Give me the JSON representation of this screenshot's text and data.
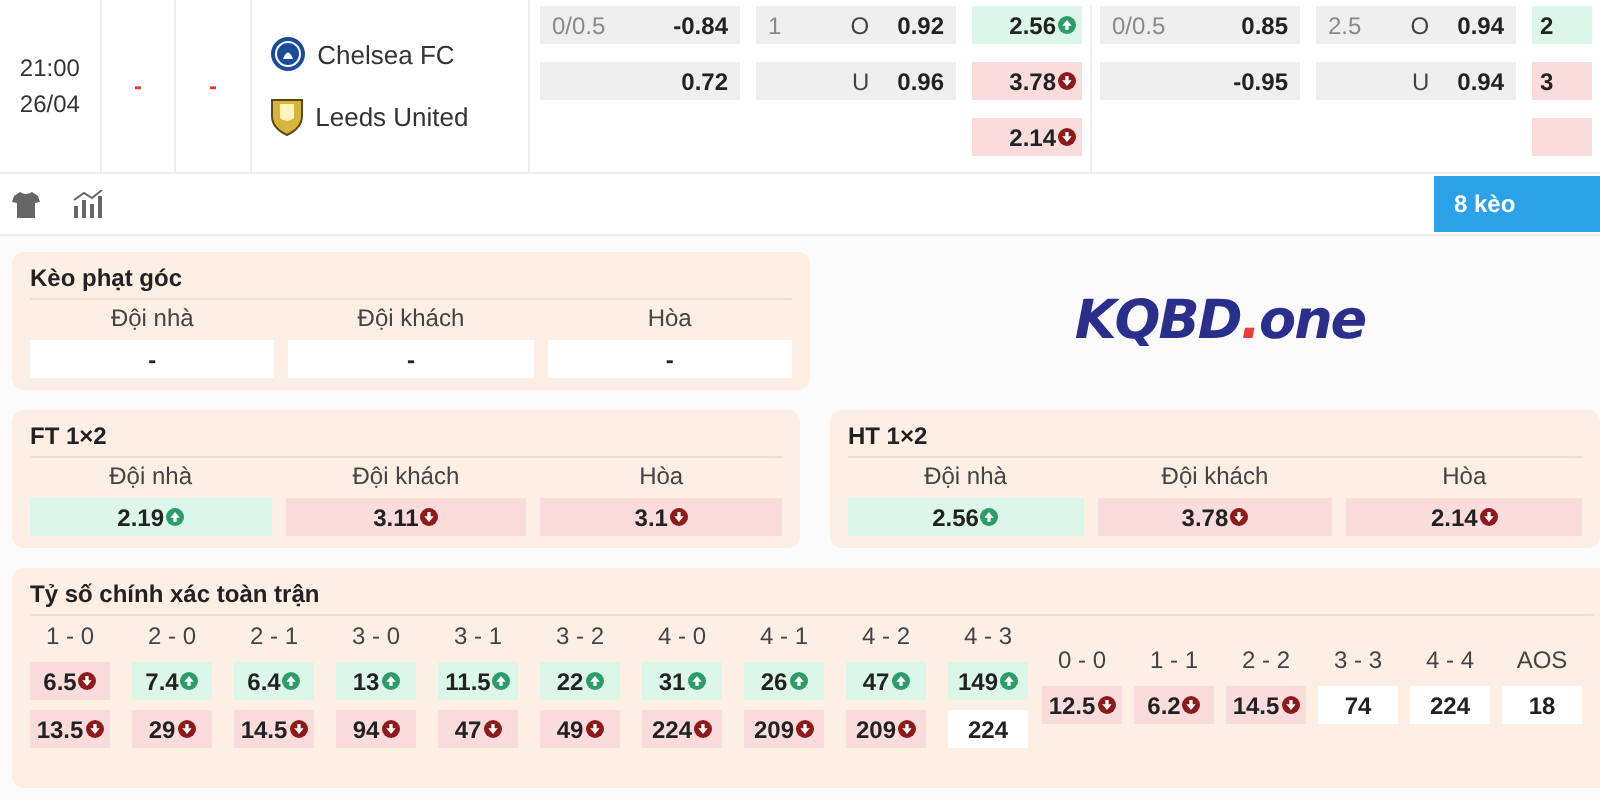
{
  "match": {
    "time": "21:00",
    "date": "26/04",
    "score_home": "-",
    "score_away": "-",
    "teams": [
      {
        "name": "Chelsea FC"
      },
      {
        "name": "Leeds United"
      }
    ]
  },
  "odds_sections": [
    {
      "groups": [
        {
          "kind": "handicap",
          "rows": [
            {
              "line": "0/0.5",
              "value": "-0.84"
            },
            {
              "value": "0.72"
            }
          ]
        },
        {
          "kind": "overunder",
          "rows": [
            {
              "line": "1",
              "side": "O",
              "value": "0.92"
            },
            {
              "side": "U",
              "value": "0.96"
            }
          ]
        },
        {
          "kind": "matchodds",
          "clipped": false,
          "rows": [
            {
              "value": "2.56",
              "kind": "up"
            },
            {
              "value": "3.78",
              "kind": "down"
            },
            {
              "value": "2.14",
              "kind": "down"
            }
          ]
        }
      ]
    },
    {
      "groups": [
        {
          "kind": "handicap",
          "rows": [
            {
              "line": "0/0.5",
              "value": "0.85"
            },
            {
              "value": "-0.95"
            }
          ]
        },
        {
          "kind": "overunder",
          "rows": [
            {
              "line": "2.5",
              "side": "O",
              "value": "0.94"
            },
            {
              "side": "U",
              "value": "0.94"
            }
          ]
        },
        {
          "kind": "matchodds",
          "clipped": true,
          "rows": [
            {
              "value": "2",
              "kind": "up"
            },
            {
              "value": "3",
              "kind": "down"
            },
            {
              "kind": "down"
            }
          ]
        }
      ]
    }
  ],
  "toolbar": {
    "more_button": "8 kèo"
  },
  "corner": {
    "title": "Kèo phạt góc",
    "columns": [
      {
        "label": "Đội nhà",
        "value": "-",
        "kind": "plain"
      },
      {
        "label": "Đội khách",
        "value": "-",
        "kind": "plain"
      },
      {
        "label": "Hòa",
        "value": "-",
        "kind": "plain"
      }
    ]
  },
  "logo": {
    "left": "KQBD",
    "dot": ".",
    "right": "one"
  },
  "ft_1x2": {
    "title": "FT 1×2",
    "columns": [
      {
        "label": "Đội nhà",
        "value": "2.19",
        "kind": "up"
      },
      {
        "label": "Đội khách",
        "value": "3.11",
        "kind": "down"
      },
      {
        "label": "Hòa",
        "value": "3.1",
        "kind": "down"
      }
    ]
  },
  "ht_1x2": {
    "title": "HT 1×2",
    "columns": [
      {
        "label": "Đội nhà",
        "value": "2.56",
        "kind": "up"
      },
      {
        "label": "Đội khách",
        "value": "3.78",
        "kind": "down"
      },
      {
        "label": "Hòa",
        "value": "2.14",
        "kind": "down"
      }
    ]
  },
  "correct_score": {
    "title": "Tỷ số chính xác toàn trận",
    "wins": [
      {
        "label": "1 - 0",
        "odds": [
          {
            "value": "6.5",
            "kind": "down"
          },
          {
            "value": "13.5",
            "kind": "down"
          }
        ]
      },
      {
        "label": "2 - 0",
        "odds": [
          {
            "value": "7.4",
            "kind": "up"
          },
          {
            "value": "29",
            "kind": "down"
          }
        ]
      },
      {
        "label": "2 - 1",
        "odds": [
          {
            "value": "6.4",
            "kind": "up"
          },
          {
            "value": "14.5",
            "kind": "down"
          }
        ]
      },
      {
        "label": "3 - 0",
        "odds": [
          {
            "value": "13",
            "kind": "up"
          },
          {
            "value": "94",
            "kind": "down"
          }
        ]
      },
      {
        "label": "3 - 1",
        "odds": [
          {
            "value": "11.5",
            "kind": "up"
          },
          {
            "value": "47",
            "kind": "down"
          }
        ]
      },
      {
        "label": "3 - 2",
        "odds": [
          {
            "value": "22",
            "kind": "up"
          },
          {
            "value": "49",
            "kind": "down"
          }
        ]
      },
      {
        "label": "4 - 0",
        "odds": [
          {
            "value": "31",
            "kind": "up"
          },
          {
            "value": "224",
            "kind": "down"
          }
        ]
      },
      {
        "label": "4 - 1",
        "odds": [
          {
            "value": "26",
            "kind": "up"
          },
          {
            "value": "209",
            "kind": "down"
          }
        ]
      },
      {
        "label": "4 - 2",
        "odds": [
          {
            "value": "47",
            "kind": "up"
          },
          {
            "value": "209",
            "kind": "down"
          }
        ]
      },
      {
        "label": "4 - 3",
        "odds": [
          {
            "value": "149",
            "kind": "up"
          },
          {
            "value": "224",
            "kind": "plain"
          }
        ]
      }
    ],
    "draws": [
      {
        "label": "0 - 0",
        "value": "12.5",
        "kind": "down"
      },
      {
        "label": "1 - 1",
        "value": "6.2",
        "kind": "down"
      },
      {
        "label": "2 - 2",
        "value": "14.5",
        "kind": "down"
      },
      {
        "label": "3 - 3",
        "value": "74",
        "kind": "plain"
      },
      {
        "label": "4 - 4",
        "value": "224",
        "kind": "plain"
      },
      {
        "label": "AOS",
        "value": "18",
        "kind": "plain"
      }
    ]
  }
}
